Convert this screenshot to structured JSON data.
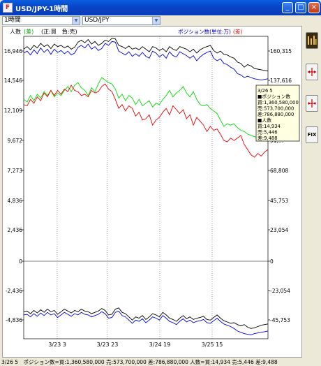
{
  "window": {
    "title": "USD/JPY-1時間",
    "icon_text": "F"
  },
  "toolbar": {
    "timeframe": "1時間",
    "symbol": "USD/JPY"
  },
  "legend": {
    "left_label": "人数",
    "left_label_paren": "(差)",
    "sign_note": "(正:買　負:売)",
    "right_label": "ポジション数(単位:万)",
    "right_label_paren": "(差)"
  },
  "tooltip": {
    "lines": [
      "3/26 5",
      "■ポジション数",
      "買:1,360,580,000",
      "売:573,700,000",
      "差:786,880,000",
      "■人数",
      "買:14,934",
      "売:5,446",
      "差:9,488"
    ]
  },
  "sidebar": {
    "buttons": [
      "chart-icon",
      "zoom-in-icon",
      "zoom-out-icon",
      "fix-icon"
    ],
    "fix_label": "FIX"
  },
  "status": {
    "text": "3/26 5　ポジション数=買:1,360,580,000 売:573,700,000 差:786,880,000 人数=買:14,934 売:5,446 差:9,488"
  },
  "colors": {
    "buy": "#000000",
    "sell": "#0000ee",
    "diff_people": "#00dd00",
    "diff_position": "#ee0000",
    "right_axis_text": "#0000cc"
  },
  "chart_data": {
    "type": "line",
    "y_left": {
      "label": "人数",
      "ticks": [
        "16,946",
        "14,546",
        "12,109",
        "9,672",
        "7,273",
        "4,836",
        "2,436",
        "0",
        "-2,436",
        "-4,836"
      ],
      "range": [
        -6000,
        17500
      ]
    },
    "y_right": {
      "label": "ポジション数(単位:万)",
      "ticks": [
        "160,315",
        "137,616",
        "114,…",
        "91,…",
        "68,808",
        "45,753",
        "23,054",
        "0",
        "-23,054",
        "-45,753"
      ],
      "range": [
        -56500,
        165000
      ]
    },
    "x_ticks": [
      "3/23 3",
      "3/23 23",
      "3/24 19",
      "3/25 15"
    ],
    "x": [
      0,
      1,
      2,
      3,
      4,
      5,
      6,
      7,
      8,
      9,
      10,
      11,
      12,
      13,
      14,
      15,
      16,
      17,
      18,
      19,
      20,
      21,
      22,
      23,
      24,
      25,
      26,
      27,
      28,
      29,
      30,
      31,
      32,
      33,
      34,
      35,
      36,
      37,
      38,
      39,
      40,
      41,
      42,
      43,
      44,
      45,
      46,
      47,
      48,
      49,
      50,
      51,
      52,
      53,
      54,
      55,
      56,
      57,
      58,
      59,
      60,
      61,
      62,
      63,
      64,
      65,
      66,
      67,
      68,
      69,
      70,
      71,
      72
    ],
    "series": [
      {
        "name": "買",
        "axis": "left",
        "color": "#000000",
        "values": [
          16500,
          16700,
          16450,
          16800,
          16600,
          16950,
          16700,
          16850,
          16550,
          16900,
          16700,
          16800,
          16600,
          16750,
          16500,
          16650,
          17050,
          17200,
          17000,
          17250,
          16900,
          17100,
          16800,
          16950,
          17200,
          17100,
          17350,
          17300,
          16800,
          16700,
          16550,
          16750,
          16500,
          16600,
          16450,
          16700,
          16500,
          16300,
          16700,
          16600,
          16400,
          16550,
          16300,
          16700,
          16500,
          16400,
          16700,
          16600,
          16500,
          16300,
          16500,
          16200,
          16450,
          16600,
          16700,
          16800,
          16400,
          16200,
          16350,
          16100,
          16050,
          15900,
          15800,
          15500,
          15400,
          15100,
          15300,
          15200,
          15000,
          14950,
          14900,
          14850,
          14800
        ]
      },
      {
        "name": "売",
        "axis": "left",
        "color": "#0000ee",
        "values": [
          16200,
          16350,
          16050,
          16450,
          16150,
          16600,
          16250,
          16500,
          16100,
          16500,
          16250,
          16400,
          16150,
          16350,
          16050,
          16200,
          16650,
          16800,
          16600,
          16900,
          16500,
          16700,
          16400,
          16550,
          16950,
          16800,
          17100,
          17050,
          16350,
          16200,
          16050,
          16300,
          15950,
          16150,
          15950,
          16250,
          15950,
          15800,
          16350,
          16200,
          15900,
          16100,
          15800,
          16300,
          16000,
          15900,
          16300,
          16150,
          16000,
          15800,
          16000,
          15600,
          15900,
          16100,
          16250,
          16350,
          15800,
          15600,
          15750,
          15400,
          15300,
          15100,
          14950,
          14600,
          14500,
          14300,
          14400,
          14300,
          14200,
          14150,
          14100,
          14150,
          14200
        ]
      },
      {
        "name": "人数差",
        "axis": "left",
        "color": "#00dd00",
        "values": [
          12600,
          12400,
          12900,
          12500,
          13000,
          12700,
          13200,
          12900,
          13300,
          12800,
          13100,
          12900,
          13300,
          13600,
          13200,
          13700,
          13900,
          13500,
          13300,
          12900,
          13500,
          13200,
          13800,
          14300,
          14100,
          13900,
          13800,
          13400,
          12700,
          13000,
          12500,
          12900,
          12700,
          12200,
          12600,
          12100,
          12300,
          12500,
          12000,
          12300,
          12200,
          12600,
          12900,
          13300,
          12800,
          13100,
          13300,
          13600,
          13100,
          12800,
          13200,
          12600,
          12200,
          12100,
          12200,
          11900,
          11700,
          11500,
          11000,
          10500,
          10700,
          10600,
          10700,
          10400,
          10200,
          10100,
          9900,
          9800,
          9700,
          9650,
          9600,
          9550,
          9500
        ]
      },
      {
        "name": "ポジション差",
        "axis": "left",
        "color": "#ee0000",
        "values": [
          12200,
          12100,
          12600,
          12300,
          12800,
          12500,
          13100,
          12800,
          13300,
          12900,
          13300,
          13000,
          13400,
          13200,
          13700,
          13300,
          13200,
          12900,
          13000,
          12800,
          13300,
          13100,
          13200,
          13600,
          13800,
          13400,
          13200,
          12600,
          11900,
          12200,
          11700,
          12100,
          11900,
          11300,
          11600,
          11000,
          11100,
          11400,
          10600,
          11000,
          11200,
          11600,
          11900,
          11400,
          12100,
          11800,
          11500,
          11800,
          11100,
          11400,
          10600,
          11200,
          10900,
          10600,
          10100,
          10500,
          10200,
          10300,
          9900,
          9400,
          9300,
          9600,
          9400,
          9600,
          9800,
          9100,
          8700,
          8300,
          8100,
          8400,
          8200,
          8500,
          8700
        ]
      },
      {
        "name": "売(差)",
        "axis": "left",
        "color": "#000000",
        "values": [
          -3900,
          -3850,
          -4050,
          -3800,
          -4000,
          -3750,
          -3950,
          -3700,
          -3900,
          -3800,
          -4100,
          -3900,
          -3700,
          -3850,
          -4000,
          -3800,
          -3900,
          -3700,
          -3850,
          -3900,
          -4050,
          -3950,
          -3850,
          -3650,
          -3800,
          -4150,
          -4100,
          -3700,
          -3600,
          -3950,
          -4050,
          -4300,
          -4550,
          -4300,
          -4400,
          -4200,
          -4500,
          -4300,
          -4050,
          -4150,
          -4300,
          -3950,
          -4150,
          -4400,
          -4500,
          -4650,
          -4400,
          -4200,
          -4450,
          -4300,
          -4500,
          -4400,
          -4350,
          -4250,
          -4500,
          -4550,
          -4350,
          -4150,
          -4400,
          -4600,
          -4700,
          -4800,
          -4750,
          -4900,
          -5000,
          -4900,
          -5100,
          -5200,
          -5150,
          -5050,
          -4950,
          -4900,
          -4850
        ]
      },
      {
        "name": "買(差)",
        "axis": "left",
        "color": "#0000ee",
        "values": [
          -4150,
          -4100,
          -4300,
          -4050,
          -4250,
          -4000,
          -4200,
          -3950,
          -4150,
          -4050,
          -4350,
          -4150,
          -3950,
          -4100,
          -4250,
          -4050,
          -4150,
          -3950,
          -4100,
          -4150,
          -4300,
          -4200,
          -4100,
          -3900,
          -4050,
          -4400,
          -4350,
          -3950,
          -3850,
          -4200,
          -4300,
          -4550,
          -4800,
          -4550,
          -4650,
          -4450,
          -4750,
          -4550,
          -4300,
          -4400,
          -4550,
          -4200,
          -4400,
          -4650,
          -4750,
          -4900,
          -4650,
          -4450,
          -4700,
          -4550,
          -4750,
          -4650,
          -4600,
          -4500,
          -4750,
          -4800,
          -4600,
          -4400,
          -4650,
          -4850,
          -4950,
          -5050,
          -5200,
          -5400,
          -5500,
          -5600,
          -5650,
          -5700,
          -5600,
          -5550,
          -5500,
          -5450,
          -5400
        ]
      }
    ]
  }
}
